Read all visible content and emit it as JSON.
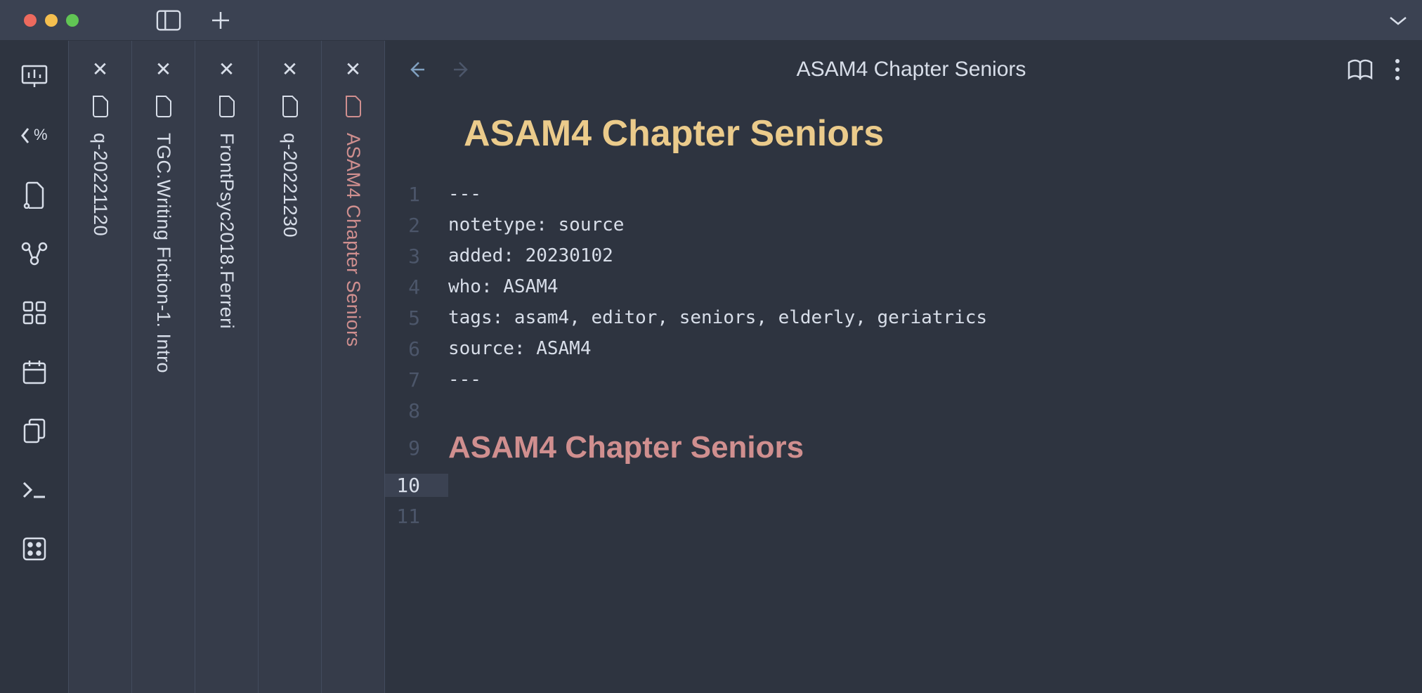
{
  "header": {
    "title": "ASAM4 Chapter Seniors"
  },
  "tabs": [
    {
      "label": "q-20221120",
      "active": false
    },
    {
      "label": "TGC.Writing Fiction-1. Intro",
      "active": false
    },
    {
      "label": "FrontPsyc2018.Ferreri",
      "active": false
    },
    {
      "label": "q-20221230",
      "active": false
    },
    {
      "label": "ASAM4 Chapter Seniors",
      "active": true
    }
  ],
  "document": {
    "title": "ASAM4 Chapter Seniors",
    "lines": [
      {
        "num": "1",
        "text": "---"
      },
      {
        "num": "2",
        "text": "notetype: source"
      },
      {
        "num": "3",
        "text": "added: 20230102"
      },
      {
        "num": "4",
        "text": "who: ASAM4"
      },
      {
        "num": "5",
        "text": "tags: asam4, editor, seniors, elderly, geriatrics"
      },
      {
        "num": "6",
        "text": "source: ASAM4"
      },
      {
        "num": "7",
        "text": "---"
      },
      {
        "num": "8",
        "text": ""
      },
      {
        "num": "9",
        "text": "ASAM4 Chapter Seniors",
        "heading": true
      },
      {
        "num": "10",
        "text": "",
        "current": true
      },
      {
        "num": "11",
        "text": ""
      }
    ]
  }
}
